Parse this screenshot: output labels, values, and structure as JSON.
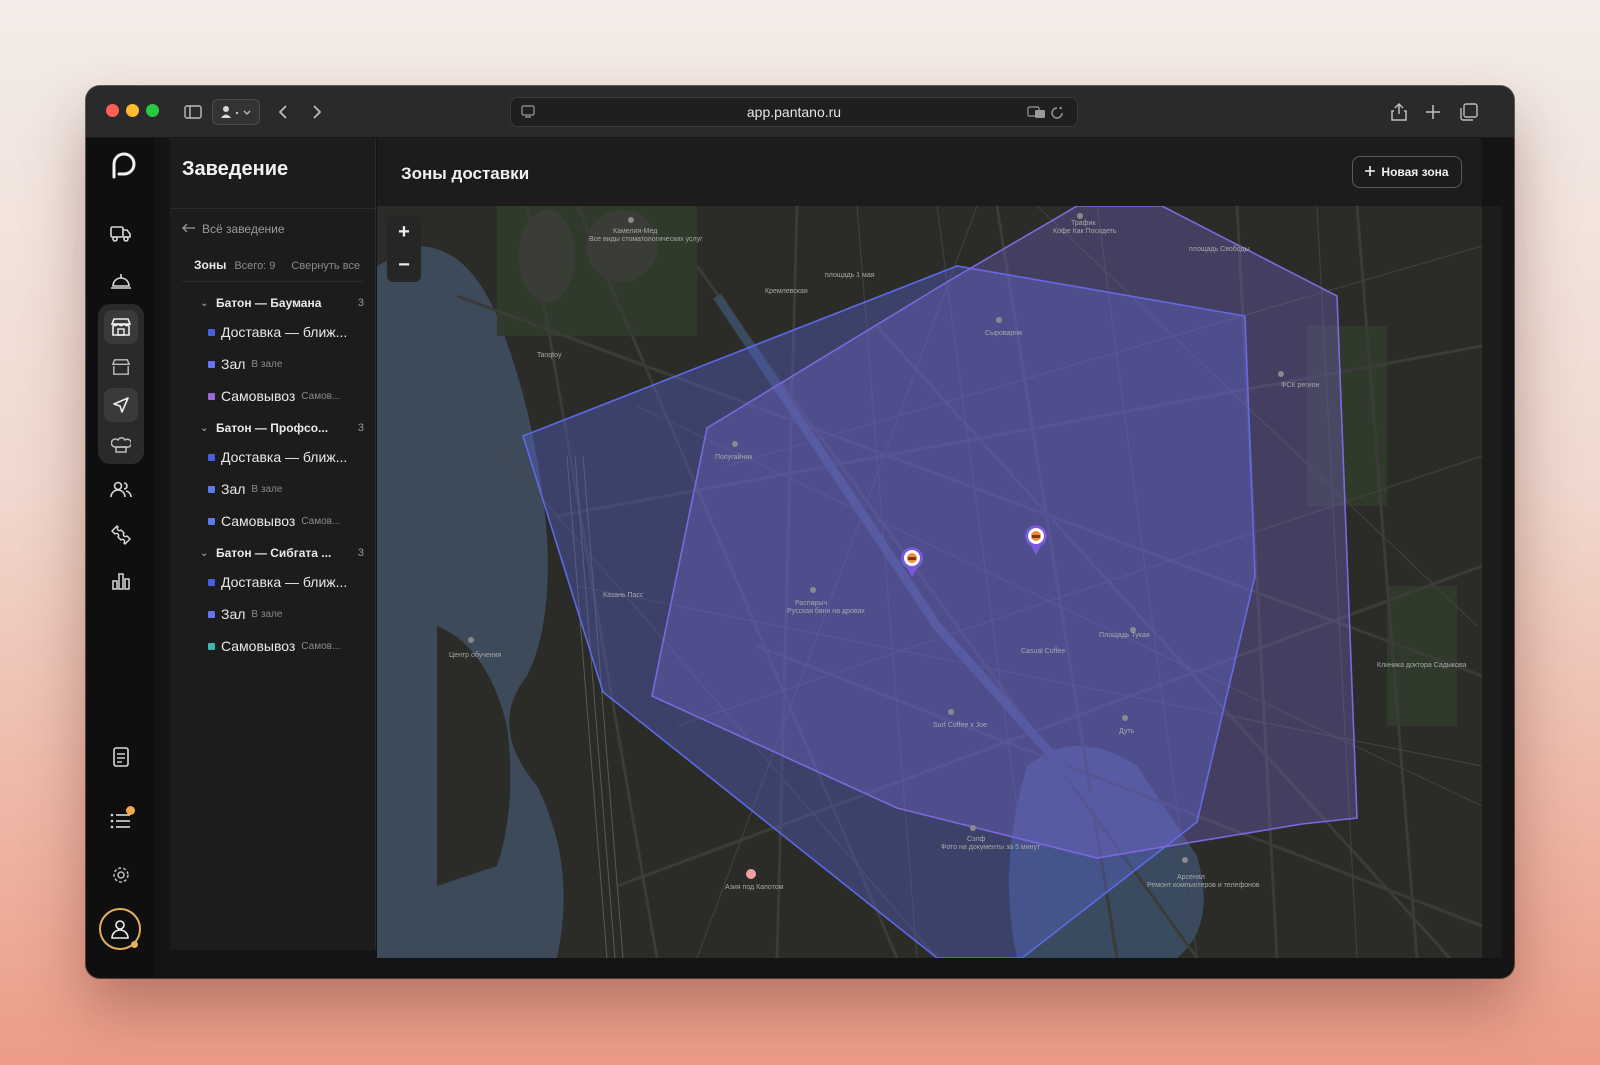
{
  "browser": {
    "url": "app.pantano.ru"
  },
  "panel": {
    "title": "Заведение",
    "back_label": "Всё заведение",
    "zones_label": "Зоны",
    "zones_total": "Всего: 9",
    "collapse_label": "Свернуть все",
    "groups": [
      {
        "name": "Батон — Баумана",
        "count": "3",
        "zones": [
          {
            "name": "Доставка — ближ...",
            "sub": "",
            "color": "#4a5fe0"
          },
          {
            "name": "Зал",
            "sub": "В зале",
            "color": "#6474f2"
          },
          {
            "name": "Самовывоз",
            "sub": "Самов...",
            "color": "#9a6ad8"
          }
        ]
      },
      {
        "name": "Батон — Профсо...",
        "count": "3",
        "zones": [
          {
            "name": "Доставка — ближ...",
            "sub": "",
            "color": "#4a5fe0"
          },
          {
            "name": "Зал",
            "sub": "В зале",
            "color": "#5a78f0"
          },
          {
            "name": "Самовывоз",
            "sub": "Самов...",
            "color": "#5a78f0"
          }
        ]
      },
      {
        "name": "Батон — Сибгата ...",
        "count": "3",
        "zones": [
          {
            "name": "Доставка — ближ...",
            "sub": "",
            "color": "#4a5fe0"
          },
          {
            "name": "Зал",
            "sub": "В зале",
            "color": "#6474f2"
          },
          {
            "name": "Самовывоз",
            "sub": "Самов...",
            "color": "#3fb4b0"
          }
        ]
      }
    ]
  },
  "main": {
    "title": "Зоны доставки",
    "new_zone_label": "Новая зона"
  },
  "map": {
    "zoom_in": "+",
    "zoom_out": "−",
    "labels": [
      {
        "text": "Камелия-Мед",
        "id": "l1"
      },
      {
        "text": "Все виды стоматологических услуг",
        "id": "l2"
      },
      {
        "text": "Трафик",
        "id": "l3"
      },
      {
        "text": "Кофе Как Посидеть",
        "id": "l4"
      },
      {
        "text": "площадь Свободы",
        "id": "l5"
      },
      {
        "text": "Кремлевская",
        "id": "l6"
      },
      {
        "text": "площадь 1 мая",
        "id": "l7"
      },
      {
        "text": "Сыроварня",
        "id": "l8"
      },
      {
        "text": "ФСК регион",
        "id": "l9"
      },
      {
        "text": "Попугайник",
        "id": "l10"
      },
      {
        "text": "Распарыч",
        "id": "l11"
      },
      {
        "text": "Русская баня на дровах",
        "id": "l12"
      },
      {
        "text": "Casual Coffee",
        "id": "l13"
      },
      {
        "text": "Surf Coffee x Joe",
        "id": "l14"
      },
      {
        "text": "Сэлф",
        "id": "l15"
      },
      {
        "text": "Фото на документы за 5 минут",
        "id": "l16"
      },
      {
        "text": "Дуть",
        "id": "l17"
      },
      {
        "text": "Арсенал",
        "id": "l18"
      },
      {
        "text": "Ремонт компьютеров и телефонов",
        "id": "l19"
      },
      {
        "text": "Азия под Капотом",
        "id": "l20"
      },
      {
        "text": "Площадь Тукая",
        "id": "l21"
      },
      {
        "text": "Казань Пасс",
        "id": "l22"
      },
      {
        "text": "Центр обучения",
        "id": "l23"
      },
      {
        "text": "Tanqtoy",
        "id": "l24"
      },
      {
        "text": "Клиника доктора Садыкова",
        "id": "l25"
      }
    ]
  },
  "colors": {
    "zone_outer": "#5b63d8",
    "zone_inner": "#7a6ad8",
    "accent_badge": "#f4a84a"
  }
}
